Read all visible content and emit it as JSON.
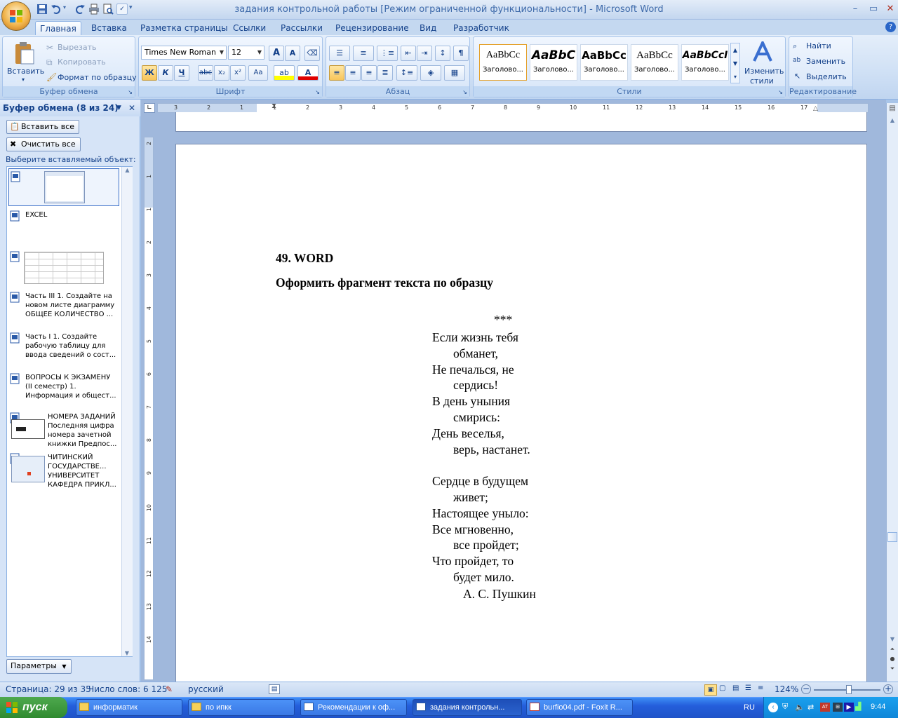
{
  "window": {
    "title": "задания контрольной работы [Режим ограниченной функциональности] - Microsoft Word"
  },
  "tabs": [
    "Главная",
    "Вставка",
    "Разметка страницы",
    "Ссылки",
    "Рассылки",
    "Рецензирование",
    "Вид",
    "Разработчик"
  ],
  "ribbon": {
    "clipboard": {
      "paste": "Вставить",
      "cut": "Вырезать",
      "copy": "Копировать",
      "format_painter": "Формат по образцу",
      "label": "Буфер обмена"
    },
    "font": {
      "name": "Times New Roman",
      "size": "12",
      "bold": "Ж",
      "italic": "К",
      "underline": "Ч",
      "strike": "abc",
      "sub": "x₂",
      "sup": "x²",
      "case": "Aa",
      "grow": "A",
      "shrink": "A",
      "color_letter": "A",
      "label": "Шрифт"
    },
    "paragraph": {
      "label": "Абзац",
      "pilcrow": "¶"
    },
    "styles": {
      "cards": [
        {
          "preview": "AaBbCc",
          "name": "Заголово..."
        },
        {
          "preview": "AaBbC",
          "name": "Заголово..."
        },
        {
          "preview": "AaBbCc",
          "name": "Заголово..."
        },
        {
          "preview": "AaBbCc",
          "name": "Заголово..."
        },
        {
          "preview": "AaBbCcI",
          "name": "Заголово..."
        }
      ],
      "change_line1": "Изменить",
      "change_line2": "стили",
      "label": "Стили"
    },
    "editing": {
      "find": "Найти",
      "replace": "Заменить",
      "select": "Выделить",
      "label": "Редактирование"
    }
  },
  "clipboard_pane": {
    "title": "Буфер обмена (8 из 24)",
    "paste_all": "Вставить все",
    "clear_all": "Очистить все",
    "prompt": "Выберите вставляемый объект:",
    "items": [
      {
        "l1": "EXCEL",
        "l2": "",
        "l3": ""
      },
      {
        "l1": "Часть III 1. Создайте на",
        "l2": "новом листе диаграмму",
        "l3": "ОБЩЕЕ КОЛИЧЕСТВО ..."
      },
      {
        "l1": "Часть I 1. Создайте",
        "l2": "рабочую таблицу для",
        "l3": "ввода сведений о сост..."
      },
      {
        "l1": "ВОПРОСЫ К ЭКЗАМЕНУ",
        "l2": "(II семестр) 1.",
        "l3": "Информация и общест..."
      }
    ],
    "thumb_items": [
      {
        "l1": "НОМЕРА ЗАДАНИЙ",
        "l2": "Последняя цифра",
        "l3": "номера зачетной",
        "l4": "книжки Предпос..."
      },
      {
        "l1": "ЧИТИНСКИЙ",
        "l2": "ГОСУДАРСТВЕ...",
        "l3": "УНИВЕРСИТЕТ",
        "l4": "КАФЕДРА ПРИКЛ..."
      }
    ],
    "options": "Параметры"
  },
  "ruler_numbers": [
    "3",
    "2",
    "1",
    "1",
    "2",
    "3",
    "4",
    "5",
    "6",
    "7",
    "8",
    "9",
    "10",
    "11",
    "12",
    "13",
    "14",
    "15",
    "16",
    "17"
  ],
  "vruler_numbers": [
    "2",
    "1",
    "1",
    "2",
    "3",
    "4",
    "5",
    "6",
    "7",
    "8",
    "9",
    "10",
    "11",
    "12",
    "13",
    "14"
  ],
  "document": {
    "heading": "49. WORD",
    "task": "Оформить фрагмент текста по образцу",
    "stars": "***",
    "poem": [
      {
        "t": "Если жизнь тебя",
        "indent": false
      },
      {
        "t": "обманет,",
        "indent": true
      },
      {
        "t": "Не печалься, не",
        "indent": false
      },
      {
        "t": "сердись!",
        "indent": true
      },
      {
        "t": "В день уныния",
        "indent": false
      },
      {
        "t": "смирись:",
        "indent": true
      },
      {
        "t": "День веселья,",
        "indent": false
      },
      {
        "t": "верь, настанет.",
        "indent": true
      },
      {
        "t": "",
        "indent": false
      },
      {
        "t": "Сердце в будущем",
        "indent": false
      },
      {
        "t": "живет;",
        "indent": true
      },
      {
        "t": "Настоящее уныло:",
        "indent": false
      },
      {
        "t": "Все мгновенно,",
        "indent": false
      },
      {
        "t": "все пройдет;",
        "indent": true
      },
      {
        "t": "Что пройдет, то",
        "indent": false
      },
      {
        "t": "будет мило.",
        "indent": true
      }
    ],
    "author": "А. С. Пушкин"
  },
  "status": {
    "page": "Страница: 29 из 35",
    "words": "Число слов: 6 125",
    "lang": "русский",
    "zoom": "124%"
  },
  "taskbar": {
    "start": "пуск",
    "tasks": [
      "информатик",
      "по ипкк",
      "Рекомендации к оф...",
      "задания контрольн...",
      "burfio04.pdf - Foxit R..."
    ],
    "lang": "RU",
    "time": "9:44"
  },
  "colors": {
    "accent": "#15428b",
    "taskbar": "#245edb",
    "start": "#2f8a2f"
  }
}
